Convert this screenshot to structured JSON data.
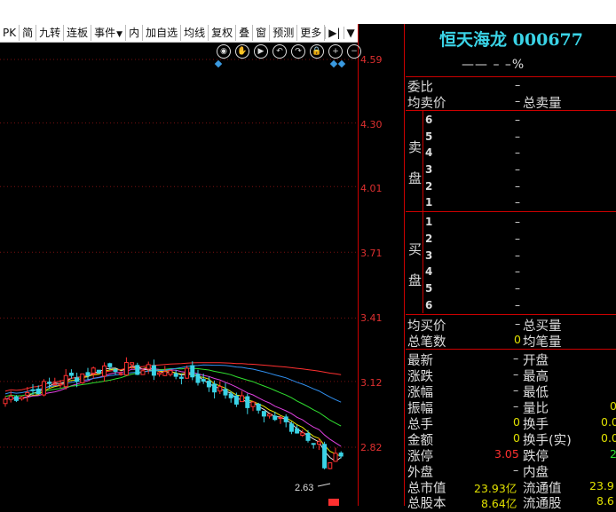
{
  "toolbar": {
    "items": [
      "PK",
      "简",
      "九转",
      "连板",
      "事件",
      "内",
      "加自选",
      "均线",
      "复权",
      "叠",
      "窗",
      "预测",
      "更多"
    ],
    "menu_caret": "▼",
    "play_icon": "▶|"
  },
  "chart": {
    "price_ticks": [
      "4.59",
      "4.30",
      "4.01",
      "3.71",
      "3.41",
      "3.12",
      "2.82"
    ],
    "low_label": "2.63",
    "tools": [
      "eye-icon",
      "hand-icon",
      "play-icon",
      "undo-icon",
      "redo-icon",
      "lock-icon",
      "zoom-in-icon",
      "zoom-out-icon"
    ],
    "up_color": "#ff3030",
    "down_color": "#3ad3e6",
    "ma_colors": [
      "#e8e8e8",
      "#e8e800",
      "#e040e0",
      "#30e030",
      "#3090f0",
      "#ff3030"
    ]
  },
  "quote": {
    "name": "恒天海龙",
    "code": "000677",
    "change": "——  –  –%",
    "weibi_label": "委比",
    "weibi_value": "–",
    "avg_sell_label": "均卖价",
    "avg_sell_value": "–",
    "total_sell_label": "总卖量",
    "sell_side_label": [
      "卖",
      "盘"
    ],
    "sell_levels": [
      "6",
      "5",
      "4",
      "3",
      "2",
      "1"
    ],
    "buy_side_label": [
      "买",
      "盘"
    ],
    "buy_levels": [
      "1",
      "2",
      "3",
      "4",
      "5",
      "6"
    ],
    "level_value": "–",
    "avg_buy_label": "均买价",
    "avg_buy_value": "–",
    "total_buy_label": "总买量",
    "trades_label": "总笔数",
    "trades_value": "0",
    "avg_vol_label": "均笔量",
    "stats_left": [
      {
        "label": "最新",
        "value": "–"
      },
      {
        "label": "涨跌",
        "value": "–"
      },
      {
        "label": "涨幅",
        "value": "–"
      },
      {
        "label": "振幅",
        "value": "–"
      },
      {
        "label": "总手",
        "value": "0"
      },
      {
        "label": "金额",
        "value": "0"
      },
      {
        "label": "涨停",
        "value": "3.05"
      },
      {
        "label": "外盘",
        "value": "–"
      },
      {
        "label": "总市值",
        "value": "23.93亿"
      },
      {
        "label": "总股本",
        "value": "8.64亿"
      }
    ],
    "stats_right": [
      {
        "label": "开盘",
        "value": ""
      },
      {
        "label": "最高",
        "value": ""
      },
      {
        "label": "最低",
        "value": ""
      },
      {
        "label": "量比",
        "value": "0"
      },
      {
        "label": "换手",
        "value": "0.0"
      },
      {
        "label": "换手(实)",
        "value": "0.0"
      },
      {
        "label": "跌停",
        "value": "2"
      },
      {
        "label": "内盘",
        "value": ""
      },
      {
        "label": "流通值",
        "value": "23.9"
      },
      {
        "label": "流通股",
        "value": "8.6"
      }
    ]
  }
}
